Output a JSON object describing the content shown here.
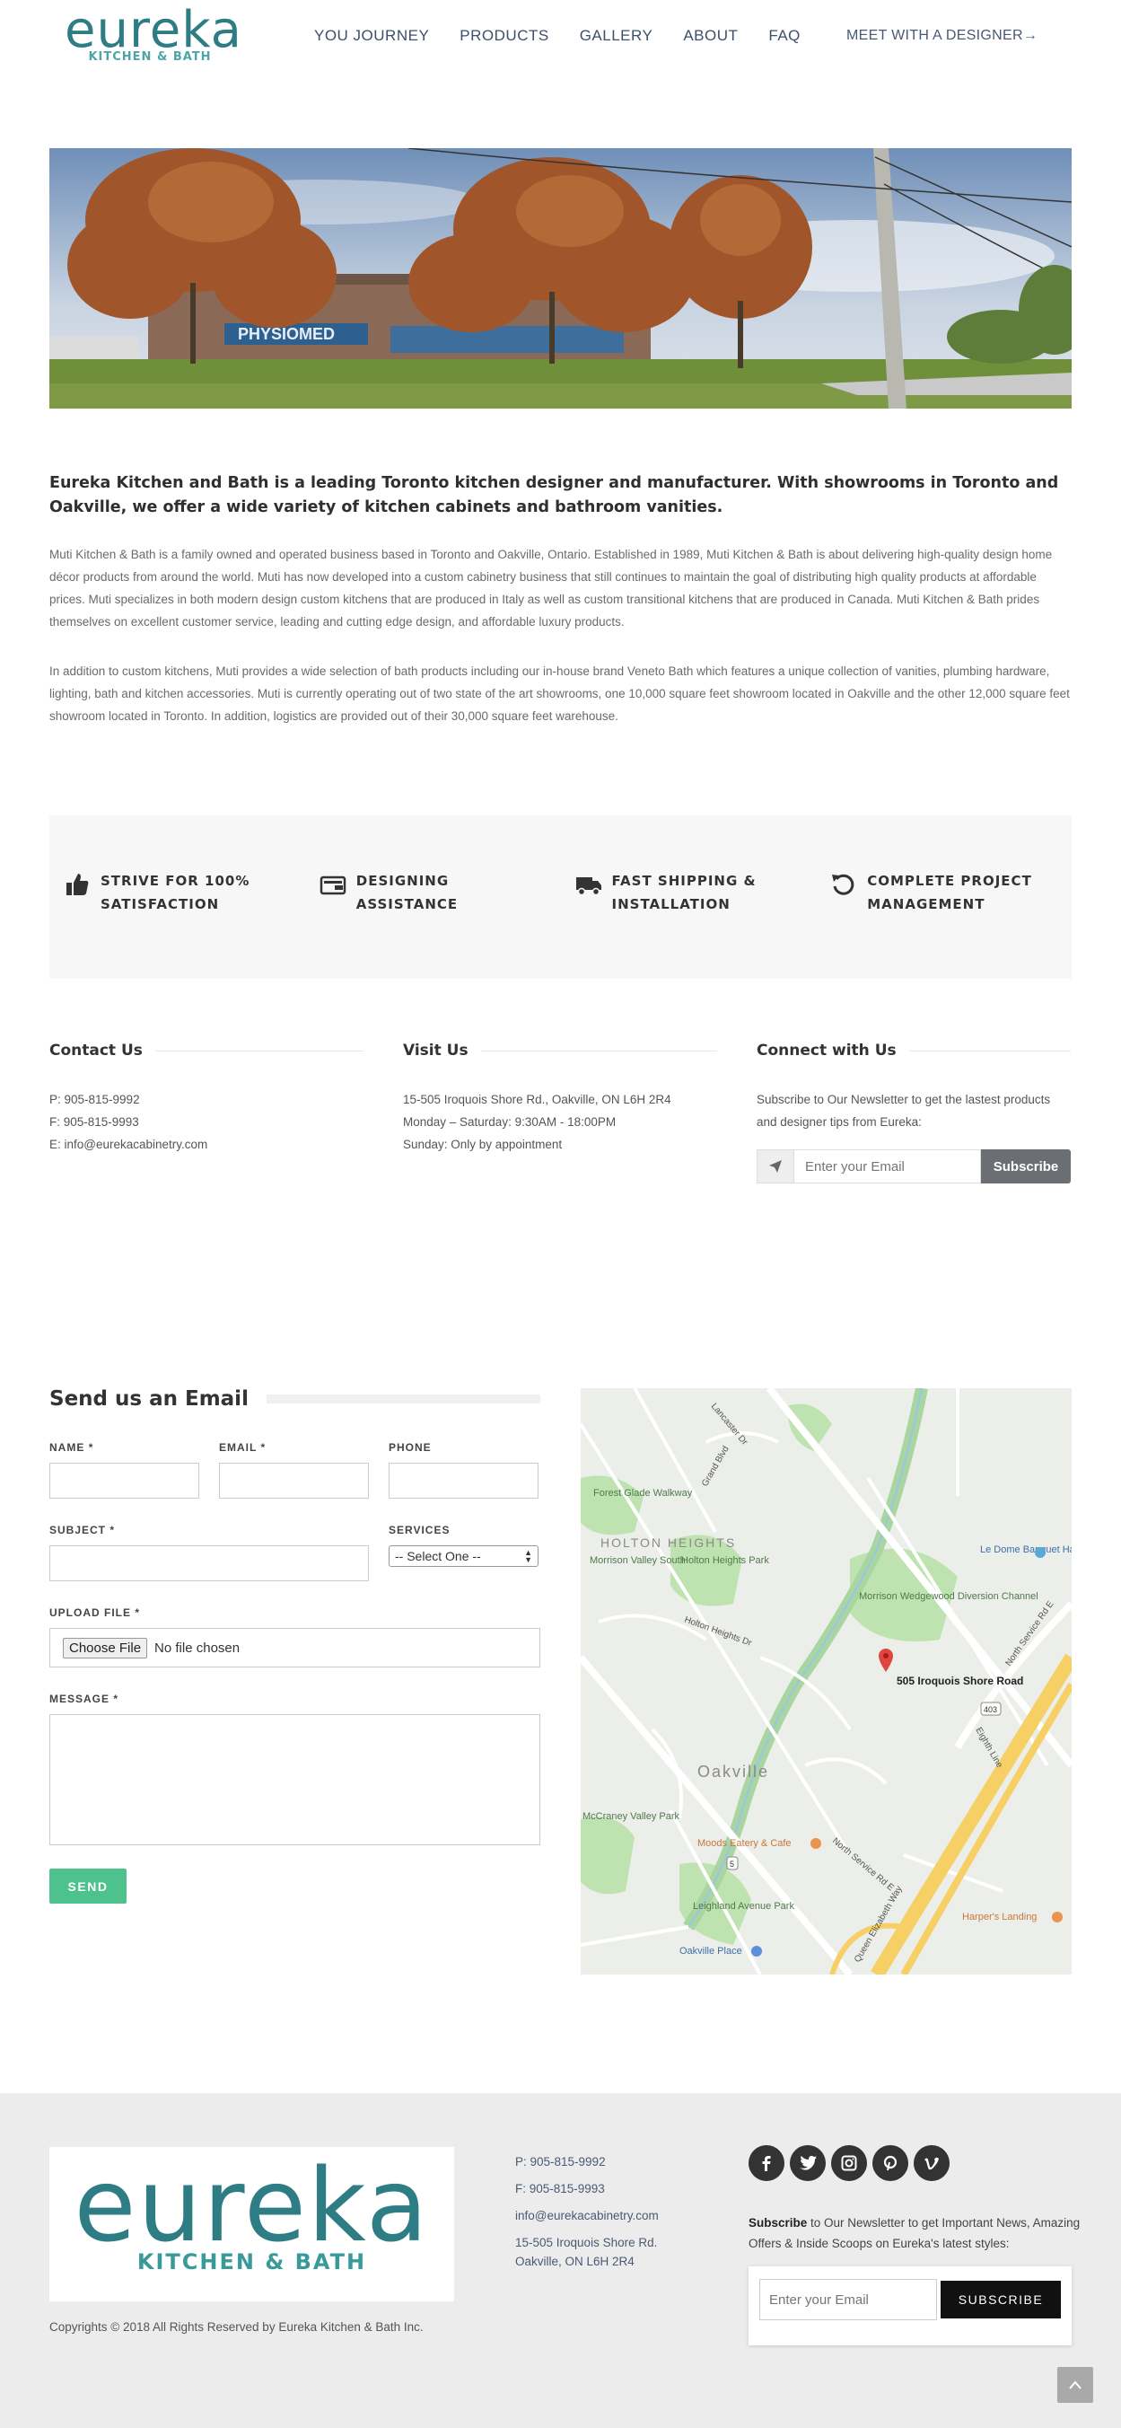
{
  "header": {
    "logo_word": "eureka",
    "logo_sub": "KITCHEN & BATH",
    "nav": [
      "YOU JOURNEY",
      "PRODUCTS",
      "GALLERY",
      "ABOUT",
      "FAQ"
    ],
    "cta": "MEET WITH A DESIGNER→"
  },
  "hero": {
    "sign_text": "PHYSIOMED"
  },
  "intro": {
    "lead": "Eureka Kitchen and Bath is a leading Toronto kitchen designer and manufacturer. With showrooms in Toronto and Oakville, we offer a wide variety of kitchen cabinets and bathroom vanities.",
    "p1": "Muti Kitchen & Bath is a family owned and operated business based in Toronto and Oakville, Ontario. Established in 1989, Muti Kitchen & Bath is about delivering high-quality design home décor products from around the world. Muti has now developed into a custom cabinetry business that still continues to maintain the goal of distributing high quality products at affordable prices. Muti specializes in both modern design custom kitchens that are produced in Italy as well as custom transitional kitchens that are produced in Canada. Muti Kitchen & Bath prides themselves on excellent customer service, leading and cutting edge design, and affordable luxury products.",
    "p2": "In addition to custom kitchens, Muti provides a wide selection of bath products including our in-house brand Veneto Bath which features a unique collection of vanities, plumbing hardware, lighting, bath and kitchen accessories. Muti is currently operating out of two state of the art showrooms, one 10,000 square feet showroom located in Oakville and the other 12,000 square feet showroom located in Toronto. In addition, logistics are provided out of their 30,000 square feet warehouse."
  },
  "features": [
    {
      "label": "STRIVE FOR 100% SATISFACTION",
      "icon": "thumbs-up-icon"
    },
    {
      "label": "DESIGNING ASSISTANCE",
      "icon": "wallet-icon"
    },
    {
      "label": "FAST SHIPPING & INSTALLATION",
      "icon": "truck-icon"
    },
    {
      "label": "COMPLETE PROJECT MANAGEMENT",
      "icon": "refresh-icon"
    }
  ],
  "contact": {
    "title": "Contact Us",
    "phone": "P: 905-815-9992",
    "fax": "F: 905-815-9993",
    "email": "E: info@eurekacabinetry.com"
  },
  "visit": {
    "title": "Visit Us",
    "address": "15-505 Iroquois Shore Rd., Oakville, ON L6H 2R4",
    "hours_weekday": "Monday – Saturday: 9:30AM - 18:00PM",
    "hours_sunday": "Sunday: Only by appointment"
  },
  "connect": {
    "title": "Connect with Us",
    "text": "Subscribe to Our Newsletter to get the lastest products and designer tips from Eureka:",
    "placeholder": "Enter your Email",
    "button": "Subscribe"
  },
  "form": {
    "title": "Send us an Email",
    "name_label": "NAME",
    "email_label": "EMAIL",
    "phone_label": "PHONE",
    "subject_label": "SUBJECT",
    "services_label": "SERVICES",
    "services_selected": "-- Select One --",
    "upload_label": "UPLOAD FILE",
    "file_button": "Choose File",
    "file_status": "No file chosen",
    "message_label": "MESSAGE",
    "required_mark": "*",
    "send": "SEND"
  },
  "map": {
    "pin_label": "505 Iroquois Shore Road",
    "labels": {
      "forest": "Forest Glade Walkway",
      "holton_heights": "HOLTON HEIGHTS",
      "morrison_valley": "Morrison Valley South",
      "holton_park": "Holton Heights Park",
      "le_dome": "Le Dome Banquet Halls Inc",
      "channel": "Morrison Wedgewood Diversion Channel",
      "oakville": "Oakville",
      "mccraney": "McCraney Valley Park",
      "moods": "Moods Eatery & Cafe",
      "leighland": "Leighland Avenue Park",
      "oakville_place": "Oakville Place",
      "harpers": "Harper's Landing",
      "eighth_line": "Eighth Line",
      "north_service_1": "North Service Rd E",
      "north_service_2": "North Service Rd E",
      "hwy": "403",
      "hwy_small": "5",
      "qew": "Queen Elizabeth Way",
      "grand_blvd": "Grand Blvd",
      "langtry": "Lancaster Dr",
      "holton_dr": "Holton Heights Dr"
    }
  },
  "footer": {
    "logo_word": "eureka",
    "logo_sub": "KITCHEN & BATH",
    "copyright": "Copyrights © 2018 All Rights Reserved by Eureka Kitchen & Bath Inc.",
    "phone": "P: 905-815-9992",
    "fax": "F: 905-815-9993",
    "email": "info@eurekacabinetry.com",
    "address_line1": "15-505 Iroquois Shore Rd.",
    "address_line2": "Oakville, ON L6H 2R4",
    "socials": [
      "facebook-icon",
      "twitter-icon",
      "instagram-icon",
      "pinterest-icon",
      "vimeo-icon"
    ],
    "nl_bold": "Subscribe",
    "nl_text": " to Our Newsletter to get Important News, Amazing Offers & Inside Scoops on Eureka's latest styles:",
    "nl_placeholder": "Enter your Email",
    "nl_button": "SUBSCRIBE"
  },
  "colors": {
    "brand_teal": "#2f7d84",
    "send_green": "#4ec28d",
    "footer_bg": "#ececec"
  }
}
